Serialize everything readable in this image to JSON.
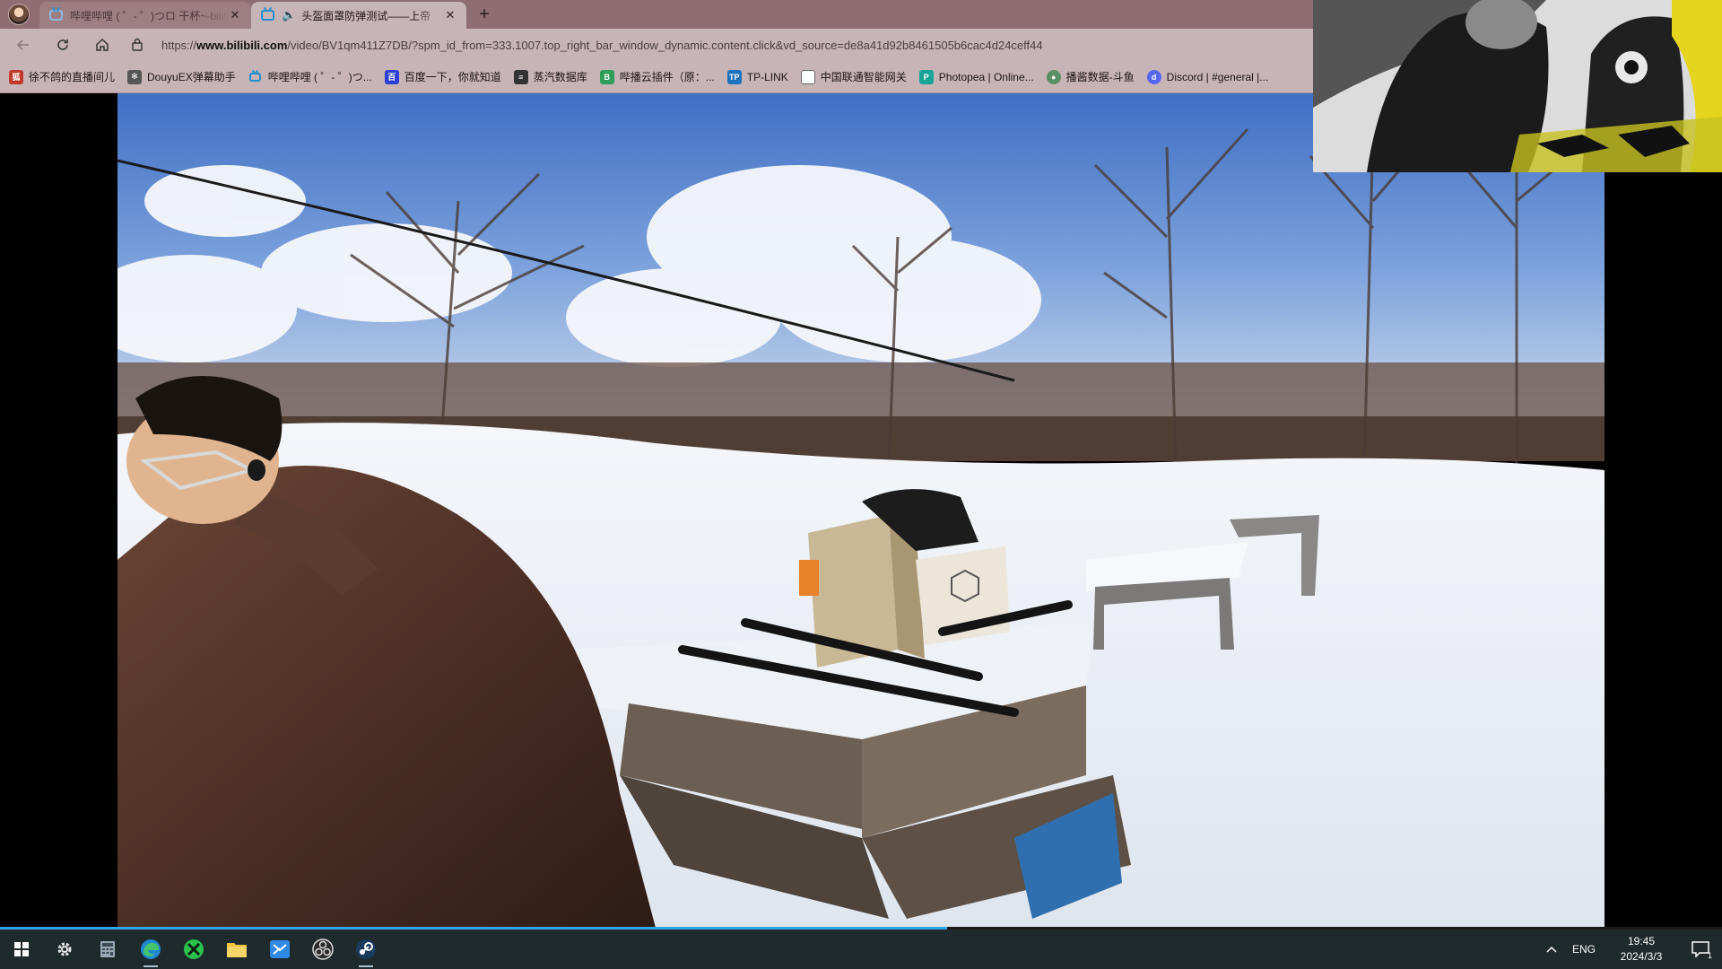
{
  "browser": {
    "tabs": [
      {
        "title": "哔哩哔哩 ( ゜- ゜)つロ 干杯~-bilibili",
        "active": false
      },
      {
        "title": "头盔面罩防弹测试——上帝",
        "active": true
      }
    ],
    "address": {
      "prefix": "https://",
      "host": "www.bilibili.com",
      "path": "/video/BV1qm411Z7DB/?spm_id_from=333.1007.top_right_bar_window_dynamic.content.click&vd_source=de8a41d92b8461505b6cac4d24ceff44"
    },
    "bookmarks": [
      {
        "label": "徐不鸽的直播间儿",
        "icon": "fox-icon",
        "color": "#c0392b"
      },
      {
        "label": "DouyuEX弹幕助手",
        "icon": "wheel-icon",
        "color": "#555555"
      },
      {
        "label": "哔哩哔哩 ( ゜- ゜)つ...",
        "icon": "bilibili-icon",
        "color": "#1f8fcf"
      },
      {
        "label": "百度一下，你就知道",
        "icon": "baidu-icon",
        "color": "#2d3fd6"
      },
      {
        "label": "蒸汽数据库",
        "icon": "database-icon",
        "color": "#333333"
      },
      {
        "label": "哔播云插件（原：...",
        "icon": "plugin-icon",
        "color": "#2f9e5b"
      },
      {
        "label": "TP-LINK",
        "icon": "tplink-icon",
        "color": "#1e73be"
      },
      {
        "label": "中国联通智能网关",
        "icon": "page-icon",
        "color": "#666666"
      },
      {
        "label": "Photopea | Online...",
        "icon": "photopea-icon",
        "color": "#18a497"
      },
      {
        "label": "播酱数据-斗鱼",
        "icon": "globe-icon",
        "color": "#5a8f63"
      },
      {
        "label": "Discord | #general |...",
        "icon": "discord-icon",
        "color": "#5865f2"
      }
    ]
  },
  "player": {
    "progress_fraction": 0.55
  },
  "taskbar": {
    "pinned": [
      "windows-start-icon",
      "settings-icon",
      "calculator-icon",
      "edge-icon",
      "xbox-icon",
      "file-explorer-icon",
      "mail-icon",
      "obs-icon",
      "steam-icon"
    ],
    "language": "ENG",
    "time": "19:45",
    "date": "2024/3/3",
    "notifications": "1"
  },
  "colors": {
    "chrome": "#c7b4b6",
    "tabbar": "#8e6e72",
    "taskbar": "#1f2a2c",
    "progress": "#2fa4e7"
  }
}
